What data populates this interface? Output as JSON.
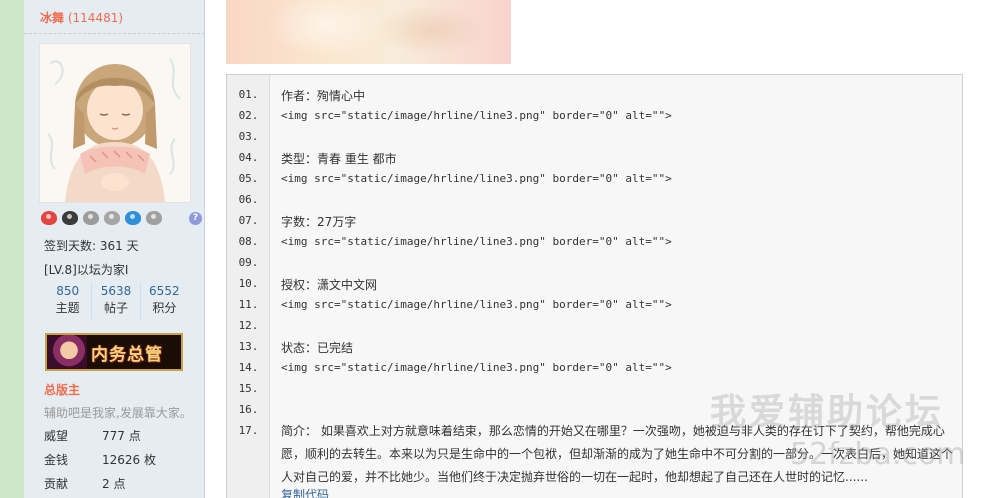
{
  "user": {
    "name": "冰舞",
    "uid": "(114481)",
    "sign_days": "签到天数: 361 天",
    "level": "[LV.8]以坛为家I",
    "stats": [
      {
        "num": "850",
        "label": "主题"
      },
      {
        "num": "5638",
        "label": "帖子"
      },
      {
        "num": "6552",
        "label": "积分"
      }
    ],
    "group_badge_text": "内务总管",
    "rank": "总版主",
    "motto": "辅助吧是我家,发展靠大家。",
    "profile": [
      {
        "key": "威望",
        "value": "777 点"
      },
      {
        "key": "金钱",
        "value": "12626 枚"
      },
      {
        "key": "贡献",
        "value": "2 点"
      }
    ],
    "medal_help": "?",
    "colors": {
      "name": "#f26c4f",
      "stat_num": "#336699"
    }
  },
  "code": {
    "line_numbers": [
      "01.",
      "02.",
      "03.",
      "04.",
      "05.",
      "06.",
      "07.",
      "08.",
      "09.",
      "10.",
      "11.",
      "12.",
      "13.",
      "14.",
      "15.",
      "16.",
      "17."
    ],
    "lines": [
      "作者：殉情心中",
      "<img src=\"static/image/hrline/line3.png\" border=\"0\" alt=\"\">",
      "",
      "类型：青春 重生 都市",
      "<img src=\"static/image/hrline/line3.png\" border=\"0\" alt=\"\">",
      "",
      "字数：27万字",
      "<img src=\"static/image/hrline/line3.png\" border=\"0\" alt=\"\">",
      "",
      "授权：潇文中文网",
      "<img src=\"static/image/hrline/line3.png\" border=\"0\" alt=\"\">",
      "",
      "状态：已完结",
      "<img src=\"static/image/hrline/line3.png\" border=\"0\" alt=\"\">",
      "",
      ""
    ],
    "summary": "简介： 如果喜欢上对方就意味着结束，那么恋情的开始又在哪里？一次强吻，她被迫与非人类的存在订下了契约，帮他完成心愿，顺利的去转生。本来以为只是生命中的一个包袱，但却渐渐的成为了她生命中不可分割的一部分。一次表白后，她知道这个人对自己的爱，并不比她少。当他们终于决定抛弃世俗的一切在一起时，他却想起了自己还在人世时的记忆......",
    "copy_label": "复制代码"
  },
  "watermark": {
    "title": "我爱辅助论坛",
    "url": "52fzba.com"
  }
}
